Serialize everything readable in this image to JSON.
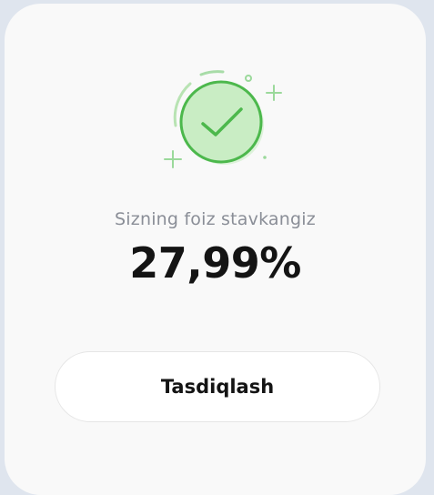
{
  "result": {
    "icon": "check-circle-success-icon",
    "subtitle": "Sizning foiz stavkangiz",
    "rate": "27,99%"
  },
  "actions": {
    "confirm_label": "Tasdiqlash"
  },
  "colors": {
    "success": "#4cb84c",
    "success_fill": "#c9edc4",
    "text_primary": "#141414",
    "text_secondary": "#8a8e97"
  }
}
